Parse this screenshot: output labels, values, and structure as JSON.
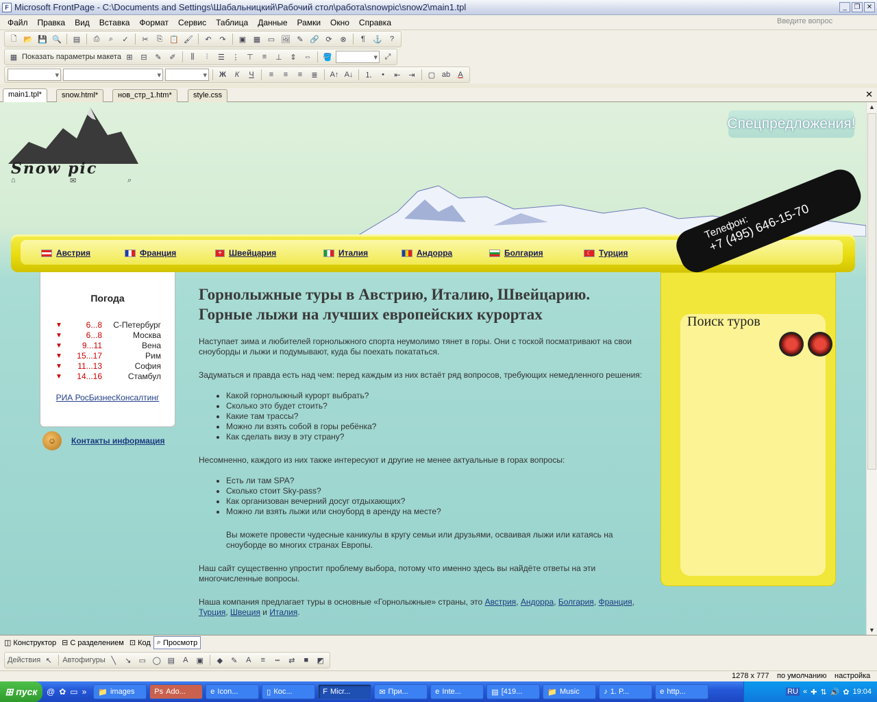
{
  "window": {
    "title": "Microsoft FrontPage - C:\\Documents and Settings\\Шабальницкий\\Рабочий стол\\работа\\snowpic\\snow2\\main1.tpl"
  },
  "menu": [
    "Файл",
    "Правка",
    "Вид",
    "Вставка",
    "Формат",
    "Сервис",
    "Таблица",
    "Данные",
    "Рамки",
    "Окно",
    "Справка"
  ],
  "ask_placeholder": "Введите вопрос",
  "toolbar2": {
    "layout_label": "Показать параметры макета"
  },
  "tabs": [
    "main1.tpl*",
    "snow.html*",
    "нов_стр_1.htm*",
    "style.css"
  ],
  "site": {
    "logo": "Snow pic",
    "special_offers": "Спецпредложения!",
    "nav": [
      {
        "label": "Австрия",
        "flag": "at"
      },
      {
        "label": "Франция",
        "flag": "fr"
      },
      {
        "label": "Швейцария",
        "flag": "ch"
      },
      {
        "label": "Италия",
        "flag": "it"
      },
      {
        "label": "Андорра",
        "flag": "ad"
      },
      {
        "label": "Болгария",
        "flag": "bg"
      },
      {
        "label": "Турция",
        "flag": "tr"
      }
    ],
    "phone_label": "Телефон:",
    "phone_number": "+7 (495) 646-15-70",
    "weather": {
      "title": "Погода",
      "rows": [
        {
          "temp": "6...8",
          "city": "С-Петербург"
        },
        {
          "temp": "6...8",
          "city": "Москва"
        },
        {
          "temp": "9...11",
          "city": "Вена"
        },
        {
          "temp": "15...17",
          "city": "Рим"
        },
        {
          "temp": "11...13",
          "city": "София"
        },
        {
          "temp": "14...16",
          "city": "Стамбул"
        }
      ],
      "source": "РИА РосБизнесКонсалтинг"
    },
    "contacts": "Контакты информация",
    "heading": "Горнолыжные туры в Австрию, Италию, Швейцарию. Горные лыжи на лучших европейских курортах",
    "p1": "Наступает зима и любителей горнолыжного спорта неумолимо тянет в горы. Они с тоской посматривают на свои сноуборды и лыжи и подумывают, куда бы поехать покататься.",
    "p2": "Задуматься и правда есть над чем: перед каждым из них встаёт ряд вопросов, требующих немедленного решения:",
    "list1": [
      "Какой горнолыжный курорт выбрать?",
      "Сколько это будет стоить?",
      "Какие там трассы?",
      "Можно ли взять  собой в горы ребёнка?",
      "Как сделать визу в эту страну?"
    ],
    "p3": "Несомненно, каждого из них также интересуют и другие не менее актуальные в горах вопросы:",
    "list2": [
      "Есть ли там SPA?",
      "Сколько стоит Sky-pass?",
      "Как организован вечерний досуг отдыхающих?",
      "Можно ли взять лыжи или сноуборд в аренду на месте?"
    ],
    "p4": "Вы можете провести чудесные каникулы в кругу семьи или друзьями, осваивая лыжи или катаясь на сноуборде во многих странах Европы.",
    "p5": "Наш сайт существенно упростит проблему выбора, потому что именно здесь вы найдёте ответы на эти многочисленные вопросы.",
    "p6_prefix": "Наша компания предлагает туры в основные «Горнолыжные» страны, это ",
    "p6_links": [
      "Австрия",
      "Андорра",
      "Болгария",
      "Франция",
      "Турция",
      "Швеция",
      "Италия"
    ],
    "p6_and": " и ",
    "search_title": "Поиск туров"
  },
  "view_tabs": [
    "Конструктор",
    "С разделением",
    "Код",
    "Просмотр"
  ],
  "drawbar": {
    "actions": "Действия",
    "autoshapes": "Автофигуры"
  },
  "status": {
    "size": "1278 x 777",
    "mode": "по умолчанию",
    "settings": "настройка"
  },
  "taskbar": {
    "start": "пуск",
    "tasks": [
      "images",
      "Ado...",
      "Icon...",
      "Кос...",
      "Micr...",
      "При...",
      "Inte...",
      "[419...",
      "Music",
      "1. P...",
      "http..."
    ],
    "lang": "RU",
    "clock": "19:04"
  }
}
